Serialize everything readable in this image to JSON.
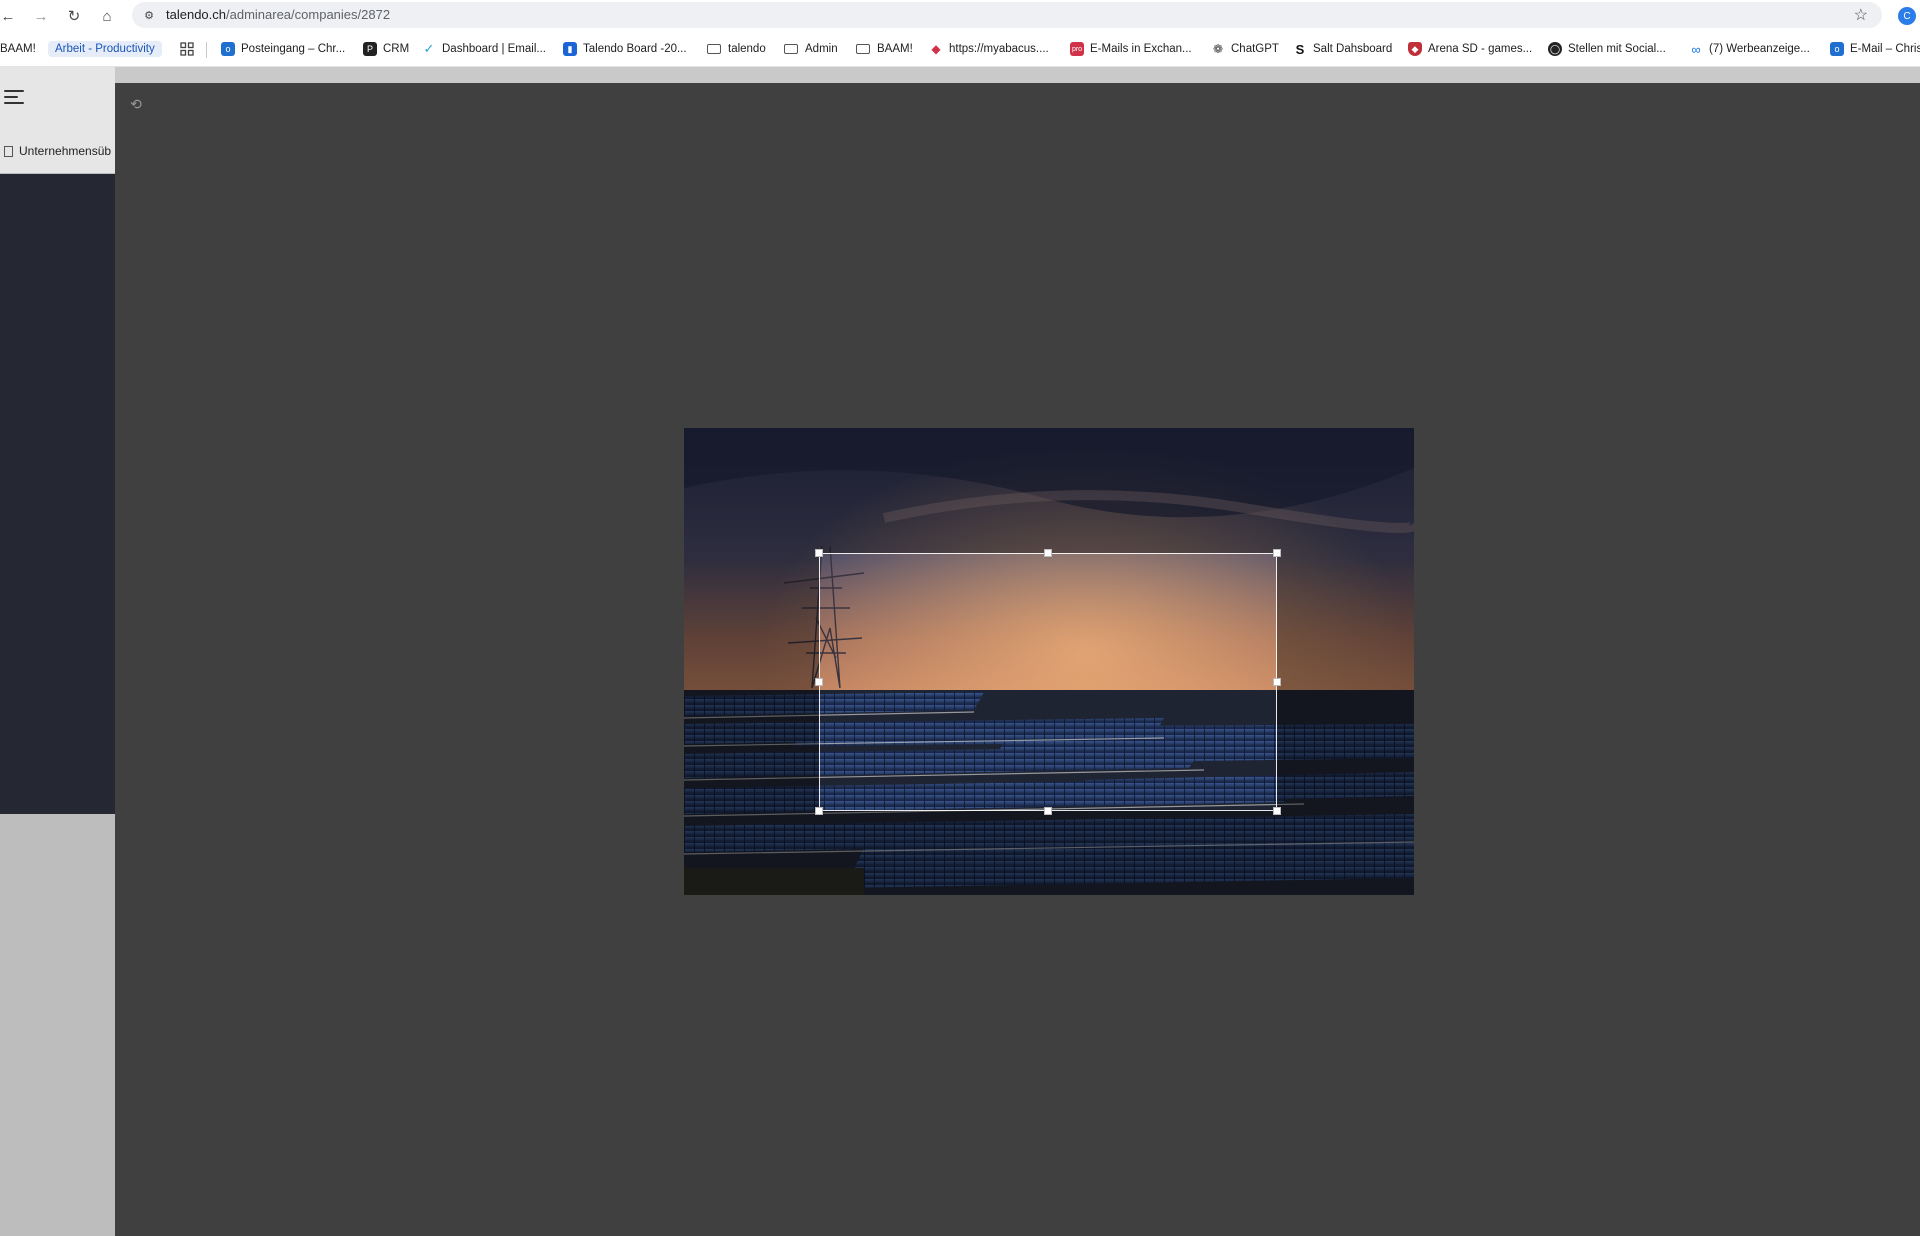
{
  "browser": {
    "url_host": "talendo.ch",
    "url_path": "/adminarea/companies/2872",
    "bookmarks": [
      {
        "label": "BAAM!",
        "type": "text"
      },
      {
        "label": "Arbeit - Productivity",
        "type": "pill"
      },
      {
        "label": "",
        "type": "apps",
        "icon": "apps-grid-icon"
      },
      {
        "label": "Posteingang – Chr...",
        "icon": "outlook-icon",
        "color": "#1f6fd0"
      },
      {
        "label": "CRM",
        "icon": "p-logo-icon",
        "color": "#222222"
      },
      {
        "label": "Dashboard | Email...",
        "icon": "checkmark-icon",
        "color": "#2aa0d8"
      },
      {
        "label": "Talendo Board -20...",
        "icon": "trello-icon",
        "color": "#1a64d6"
      },
      {
        "label": "talendo",
        "icon": "folder-icon"
      },
      {
        "label": "Admin",
        "icon": "folder-icon"
      },
      {
        "label": "BAAM!",
        "icon": "folder-icon"
      },
      {
        "label": "https://myabacus....",
        "icon": "abacus-icon",
        "color": "#d0324a"
      },
      {
        "label": "E-Mails in Exchan...",
        "icon": "pro-logo-icon",
        "color": "#d0324a"
      },
      {
        "label": "ChatGPT",
        "icon": "chatgpt-icon",
        "color": "#444444"
      },
      {
        "label": "Salt Dahsboard",
        "icon": "salt-s-icon",
        "color": "#111111"
      },
      {
        "label": "Arena SD - games...",
        "icon": "shield-badge-icon",
        "color": "#c0303a"
      },
      {
        "label": "Stellen mit Social...",
        "icon": "globe-icon",
        "color": "#222222"
      },
      {
        "label": "(7) Werbeanzeige...",
        "icon": "meta-icon",
        "color": "#1877f2"
      },
      {
        "label": "E-Mail – Chris",
        "icon": "outlook-icon",
        "color": "#1f6fd0"
      }
    ]
  },
  "sidebar": {
    "menu_icon": "hamburger-menu-icon",
    "items": [
      {
        "label": "Unternehmensüb",
        "icon": "building-icon"
      }
    ]
  },
  "cropper": {
    "reset_icon": "history-reset-icon",
    "image_subject": "solar panel field at sunset with power pylon"
  },
  "colors": {
    "overlay": "#404040",
    "sidebar_dark": "#252733",
    "accent_pill_bg": "#e6edf9",
    "accent_pill_text": "#1a56b8"
  }
}
